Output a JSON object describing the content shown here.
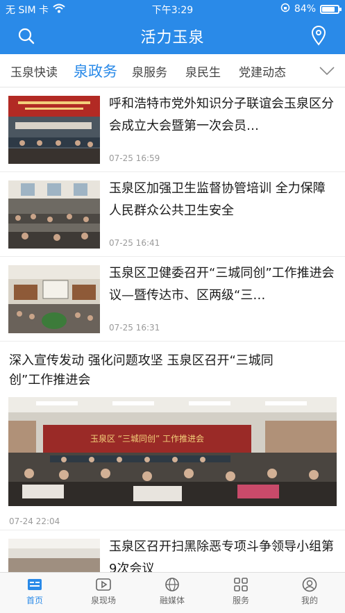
{
  "status": {
    "carrier": "无 SIM 卡",
    "time": "下午3:29",
    "battery": "84%",
    "battery_level": 0.84
  },
  "header": {
    "title": "活力玉泉"
  },
  "tabs": [
    {
      "label": "玉泉快读"
    },
    {
      "label": "泉政务"
    },
    {
      "label": "泉服务"
    },
    {
      "label": "泉民生"
    },
    {
      "label": "党建动态"
    }
  ],
  "news": [
    {
      "title": "呼和浩特市党外知识分子联谊会玉泉区分会成立大会暨第一次会员…",
      "time": "07-25 16:59"
    },
    {
      "title": "玉泉区加强卫生监督协管培训 全力保障人民群众公共卫生安全",
      "time": "07-25 16:41"
    },
    {
      "title": "玉泉区卫健委召开“三城同创”工作推进会议—暨传达市、区两级“三…",
      "time": "07-25 16:31"
    },
    {
      "title": "深入宣传发动 强化问题攻坚 玉泉区召开“三城同创”工作推进会",
      "time": "07-24 22:04",
      "banner": "玉泉区 “三城同创” 工作推进会"
    },
    {
      "title": "玉泉区召开扫黑除恶专项斗争领导小组第9次会议"
    }
  ],
  "tabbar": [
    {
      "label": "首页"
    },
    {
      "label": "泉现场"
    },
    {
      "label": "融媒体"
    },
    {
      "label": "服务"
    },
    {
      "label": "我的"
    }
  ],
  "colors": {
    "accent": "#2a8ae8"
  }
}
